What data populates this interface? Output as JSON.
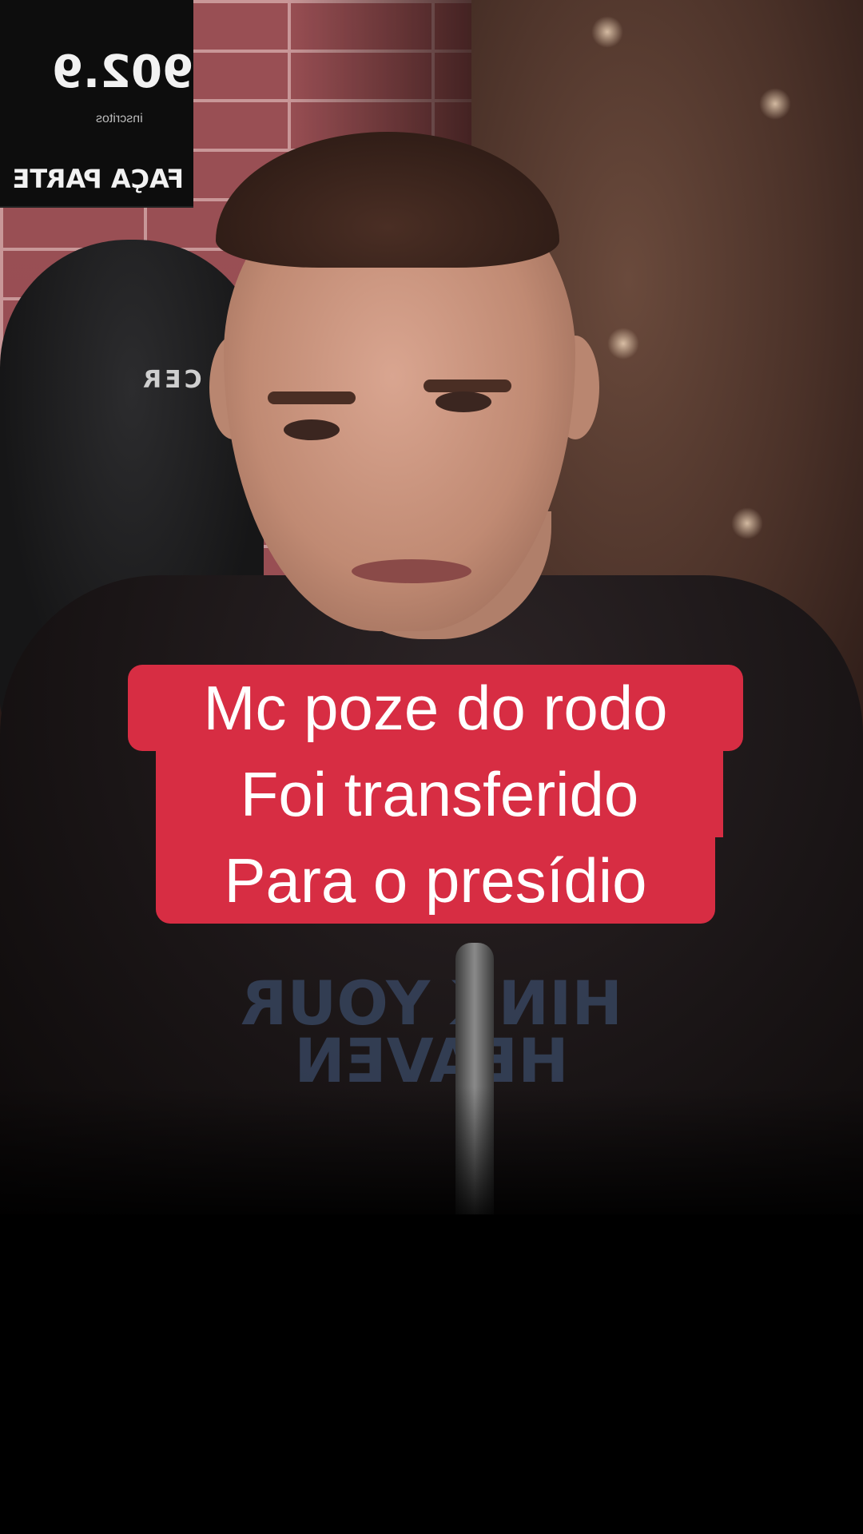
{
  "overlay": {
    "subscriber_count": "902.9",
    "subscriber_label": "inscritos",
    "cta": "FAÇA PARTE"
  },
  "chair": {
    "brand_text": "CER"
  },
  "shirt": {
    "print_text": "HINK YOUR HEAVEN"
  },
  "caption": {
    "lines": [
      "Mc poze do rodo",
      "Foi transferido",
      "Para o presídio"
    ],
    "background": "#d72d43",
    "text_color": "#ffffff"
  }
}
